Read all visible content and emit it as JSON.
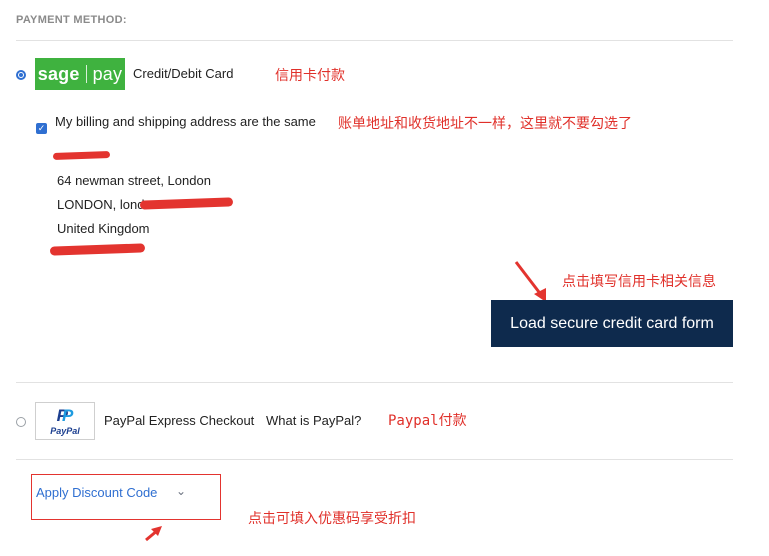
{
  "section_title": "PAYMENT METHOD:",
  "sagepay": {
    "logo_left": "sage",
    "logo_right": "pay",
    "label": "Credit/Debit Card",
    "annotation": "信用卡付款"
  },
  "billing": {
    "same_address_label": "My billing and shipping address are the same",
    "annotation": "账单地址和收货地址不一样，这里就不要勾选了",
    "address": {
      "line1": "64 newman street, London",
      "line2": "LONDON, lond",
      "line3": "United Kingdom"
    }
  },
  "load_button": {
    "label": "Load secure credit card form",
    "annotation": "点击填写信用卡相关信息"
  },
  "paypal": {
    "logo_text": "PayPal",
    "label": "PayPal Express Checkout",
    "what_is_link": "What is PayPal?",
    "annotation": "Paypal付款"
  },
  "discount": {
    "link": "Apply Discount Code",
    "annotation": "点击可填入优惠码享受折扣"
  },
  "colors": {
    "annotation_red": "#e3342f",
    "sagepay_green": "#3fb23f",
    "button_navy": "#0e2a4d",
    "link_blue": "#2f6fd1"
  }
}
